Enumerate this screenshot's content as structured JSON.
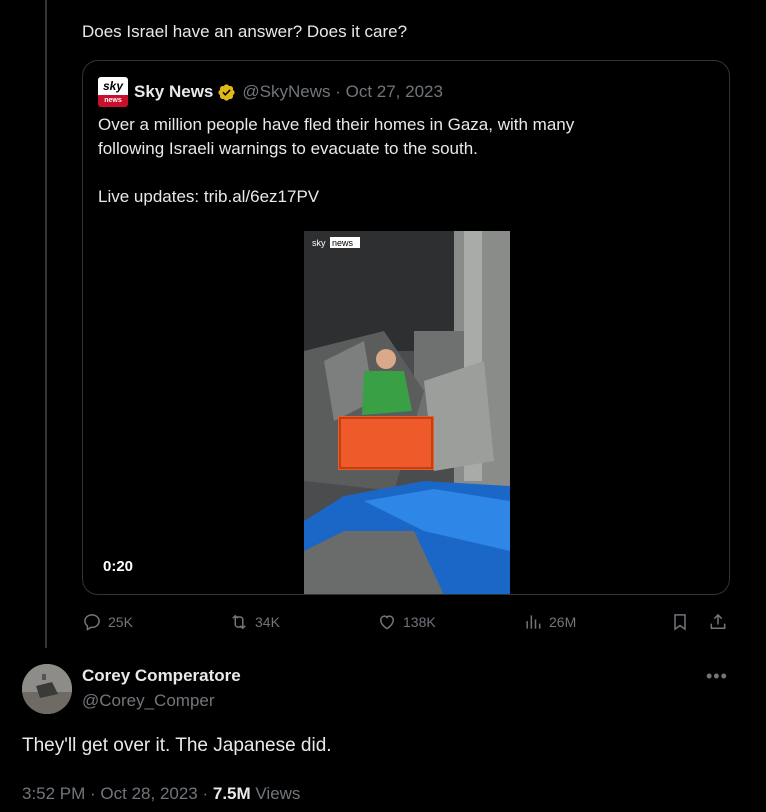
{
  "thread": {
    "partial_line": "Does Israel have an answer? Does it care?"
  },
  "quote": {
    "logo_top": "sky",
    "logo_bottom": "news",
    "name": "Sky News",
    "handle_date": "@SkyNews · Oct 27, 2023",
    "body": "Over a million people have fled their homes in Gaza, with many\nfollowing Israeli warnings to evacuate to the south.\n\nLive updates: trib.al/6ez17PV",
    "video_watermark": "sky news",
    "duration": "0:20"
  },
  "actions": {
    "replies": "25K",
    "reposts": "34K",
    "likes": "138K",
    "views": "26M"
  },
  "reply": {
    "name": "Corey Comperatore",
    "handle": "@Corey_Comper",
    "text": "They'll get over it. The Japanese did.",
    "time": "3:52 PM · Oct 28, 2023 · ",
    "views_count": "7.5M",
    "views_label": " Views"
  },
  "colors": {
    "background": "#000000",
    "text": "#e7e9ea",
    "muted": "#71767b",
    "border": "#2f3336",
    "verified_gold": "#e2b719"
  }
}
